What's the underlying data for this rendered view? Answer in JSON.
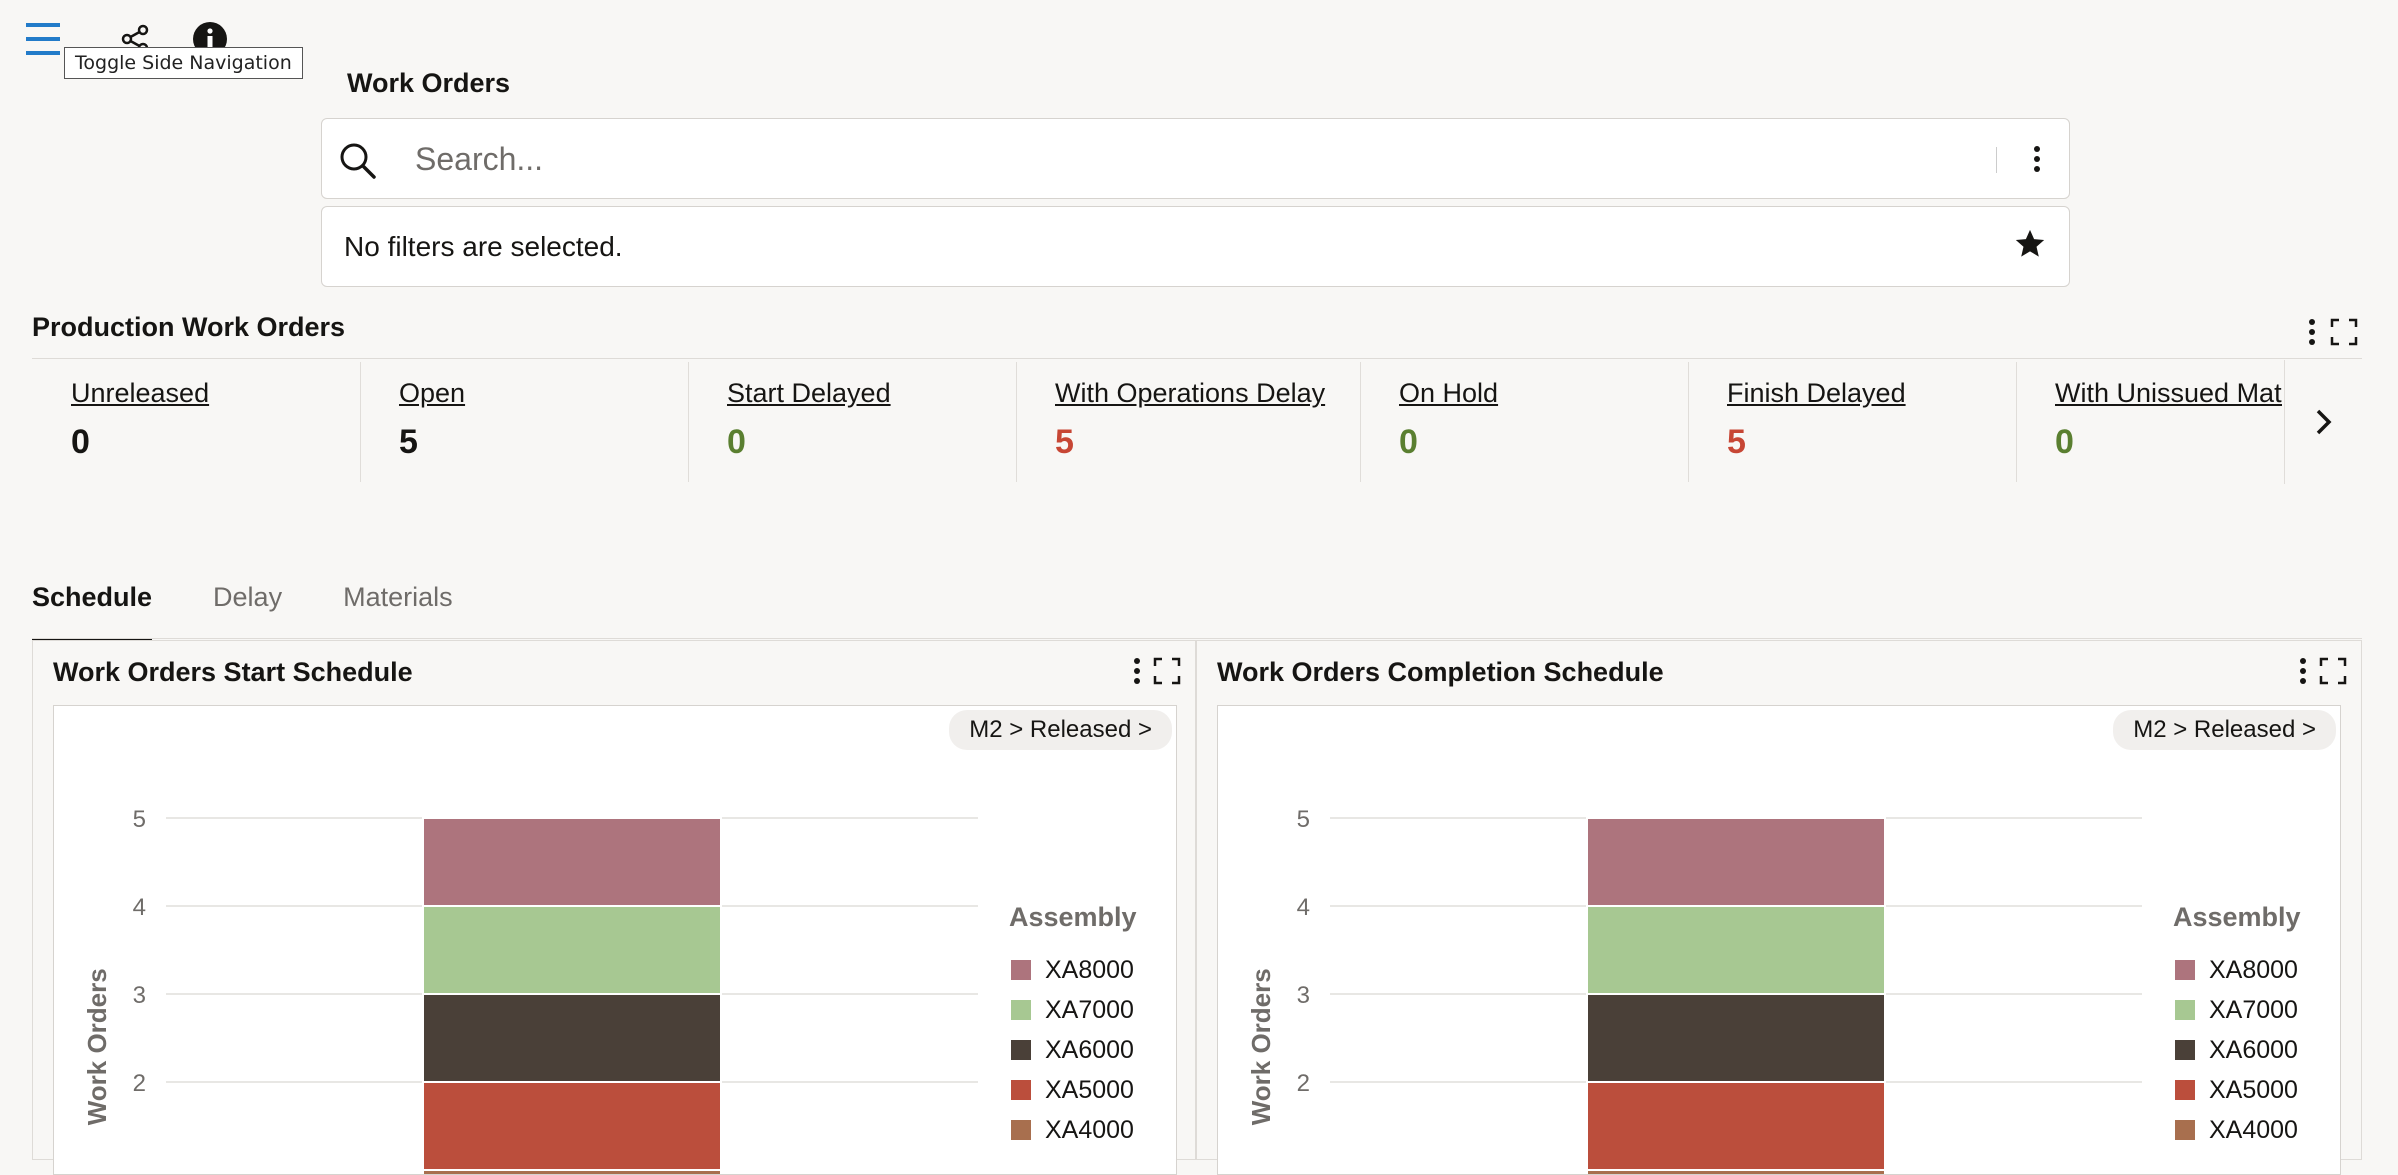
{
  "toolbar": {
    "menu_icon": "hamburger-menu-icon",
    "share_icon": "share-icon",
    "info_icon": "info-icon",
    "tooltip": "Toggle Side Navigation"
  },
  "page": {
    "title": "Work Orders"
  },
  "search": {
    "placeholder": "Search...",
    "value": ""
  },
  "filters": {
    "text": "No filters are selected."
  },
  "production": {
    "title": "Production Work Orders",
    "metrics": [
      {
        "label": "Unreleased",
        "value": "0",
        "color": "#161513"
      },
      {
        "label": "Open",
        "value": "5",
        "color": "#161513"
      },
      {
        "label": "Start Delayed",
        "value": "0",
        "color": "#5a7f30"
      },
      {
        "label": "With Operations Delay",
        "value": "5",
        "color": "#c74634"
      },
      {
        "label": "On Hold",
        "value": "0",
        "color": "#5a7f30"
      },
      {
        "label": "Finish Delayed",
        "value": "5",
        "color": "#c74634"
      },
      {
        "label": "With Unissued Materials",
        "value": "0",
        "color": "#5a7f30"
      }
    ]
  },
  "tabs": [
    {
      "label": "Schedule",
      "active": true
    },
    {
      "label": "Delay",
      "active": false
    },
    {
      "label": "Materials",
      "active": false
    }
  ],
  "cards": [
    {
      "title": "Work Orders Start Schedule",
      "crumb": "M2 > Released >"
    },
    {
      "title": "Work Orders Completion Schedule",
      "crumb": "M2 > Released >"
    }
  ],
  "chart_data": [
    {
      "type": "bar",
      "stacked": true,
      "title": "Work Orders Start Schedule",
      "ylabel": "Work Orders",
      "y_ticks": [
        "5",
        "4",
        "3",
        "2"
      ],
      "ylim": [
        1,
        5
      ],
      "legend_title": "Assembly",
      "legend_position": "right",
      "series": [
        {
          "name": "XA4000",
          "values": [
            1
          ],
          "color": "#a86f4e"
        },
        {
          "name": "XA5000",
          "values": [
            1
          ],
          "color": "#bb4e3c"
        },
        {
          "name": "XA6000",
          "values": [
            1
          ],
          "color": "#4a4038"
        },
        {
          "name": "XA7000",
          "values": [
            1
          ],
          "color": "#a7c892"
        },
        {
          "name": "XA8000",
          "values": [
            1
          ],
          "color": "#ad747d"
        }
      ]
    },
    {
      "type": "bar",
      "stacked": true,
      "title": "Work Orders Completion Schedule",
      "ylabel": "Work Orders",
      "y_ticks": [
        "5",
        "4",
        "3",
        "2"
      ],
      "ylim": [
        1,
        5
      ],
      "legend_title": "Assembly",
      "legend_position": "right",
      "series": [
        {
          "name": "XA4000",
          "values": [
            1
          ],
          "color": "#a86f4e"
        },
        {
          "name": "XA5000",
          "values": [
            1
          ],
          "color": "#bb4e3c"
        },
        {
          "name": "XA6000",
          "values": [
            1
          ],
          "color": "#4a4038"
        },
        {
          "name": "XA7000",
          "values": [
            1
          ],
          "color": "#a7c892"
        },
        {
          "name": "XA8000",
          "values": [
            1
          ],
          "color": "#ad747d"
        }
      ]
    }
  ]
}
